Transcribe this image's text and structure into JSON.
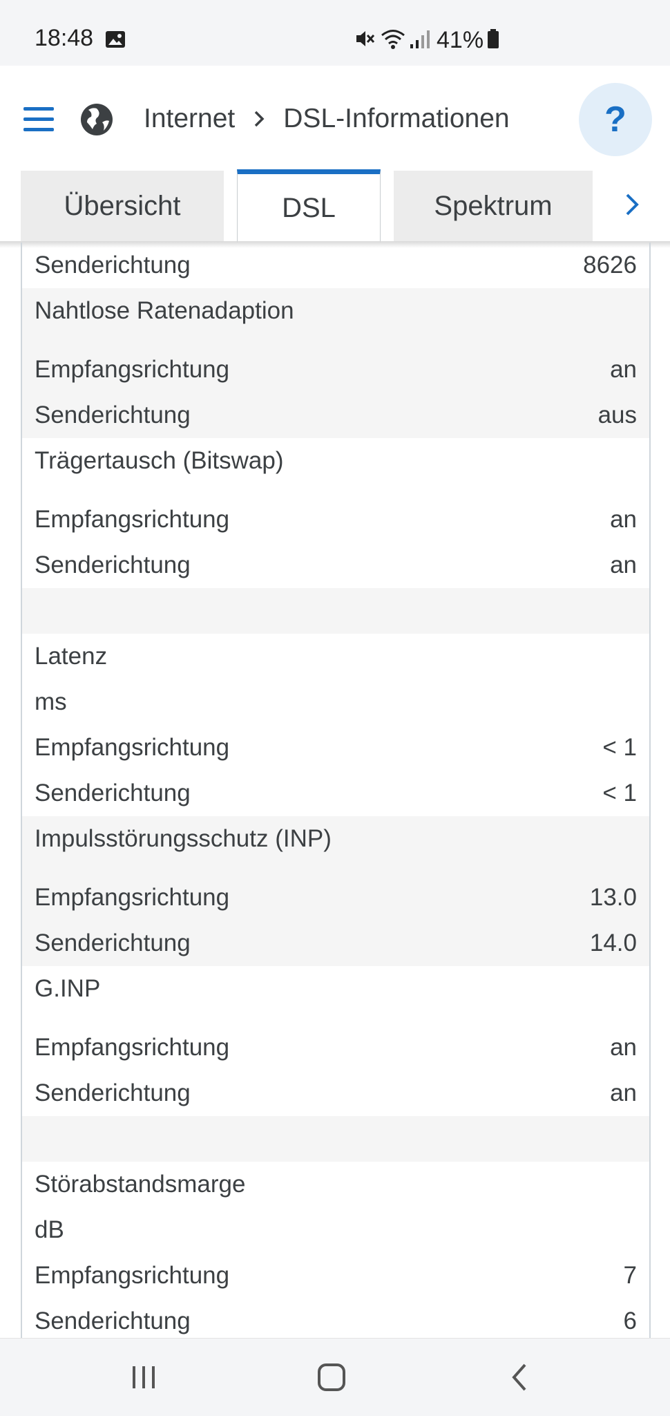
{
  "status_bar": {
    "time": "18:48",
    "battery": "41%",
    "icons": [
      "gallery-icon",
      "mute-icon",
      "wifi-icon",
      "signal-icon",
      "battery-icon"
    ]
  },
  "header": {
    "breadcrumb": [
      "Internet",
      "DSL-Informationen"
    ],
    "help_label": "?"
  },
  "tabs": [
    {
      "label": "Übersicht",
      "active": false
    },
    {
      "label": "DSL",
      "active": true
    },
    {
      "label": "Spektrum",
      "active": false
    }
  ],
  "sections": [
    {
      "title": "",
      "unit": "",
      "rows": [
        {
          "label": "Senderichtung",
          "value": "8626"
        }
      ]
    },
    {
      "title": "Nahtlose Ratenadaption",
      "rows": [
        {
          "label": "Empfangsrichtung",
          "value": "an"
        },
        {
          "label": "Senderichtung",
          "value": "aus"
        }
      ]
    },
    {
      "title": "Trägertausch (Bitswap)",
      "rows": [
        {
          "label": "Empfangsrichtung",
          "value": "an"
        },
        {
          "label": "Senderichtung",
          "value": "an"
        }
      ]
    },
    {
      "title": "Latenz",
      "unit": "ms",
      "rows": [
        {
          "label": "Empfangsrichtung",
          "value": "< 1"
        },
        {
          "label": "Senderichtung",
          "value": "< 1"
        }
      ]
    },
    {
      "title": "Impulsstörungsschutz (INP)",
      "rows": [
        {
          "label": "Empfangsrichtung",
          "value": "13.0"
        },
        {
          "label": "Senderichtung",
          "value": "14.0"
        }
      ]
    },
    {
      "title": "G.INP",
      "rows": [
        {
          "label": "Empfangsrichtung",
          "value": "an"
        },
        {
          "label": "Senderichtung",
          "value": "an"
        }
      ]
    },
    {
      "title": "Störabstandsmarge",
      "unit": "dB",
      "rows": [
        {
          "label": "Empfangsrichtung",
          "value": "7"
        },
        {
          "label": "Senderichtung",
          "value": "6"
        }
      ]
    }
  ],
  "colors": {
    "accent": "#1a6fc4",
    "row_alt": "#f5f5f5",
    "help_bg": "#e2eef9"
  }
}
